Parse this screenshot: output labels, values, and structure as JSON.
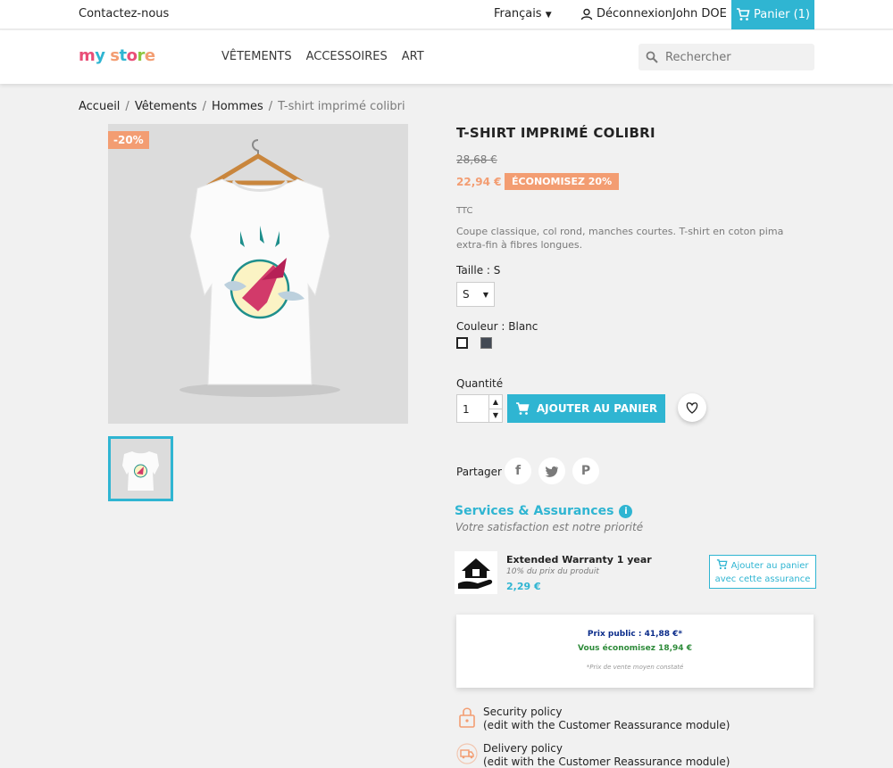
{
  "topbar": {
    "contact": "Contactez-nous",
    "language": "Français",
    "logout": "Déconnexion",
    "user": "John DOE",
    "cart": "Panier (1)"
  },
  "header": {
    "logo": "my store",
    "nav": [
      "VÊTEMENTS",
      "ACCESSOIRES",
      "ART"
    ],
    "search_placeholder": "Rechercher"
  },
  "breadcrumb": [
    "Accueil",
    "Vêtements",
    "Hommes",
    "T-shirt imprimé colibri"
  ],
  "product": {
    "discount_flag": "-20%",
    "title": "T-SHIRT IMPRIMÉ COLIBRI",
    "old_price": "28,68 €",
    "price": "22,94 €",
    "save_badge": "ÉCONOMISEZ 20%",
    "tax_label": "TTC",
    "description": "Coupe classique, col rond, manches courtes. T-shirt en coton pima extra-fin à fibres longues.",
    "size_label": "Taille : S",
    "size_value": "S",
    "color_label": "Couleur : Blanc",
    "colors": [
      "#ffffff",
      "#434a54"
    ],
    "qty_label": "Quantité",
    "qty_value": "1",
    "add_to_cart": "AJOUTER AU PANIER",
    "share_label": "Partager"
  },
  "services": {
    "title": "Services & Assurances",
    "subtitle": "Votre satisfaction est notre priorité",
    "warranty_name": "Extended Warranty 1 year",
    "warranty_sub": "10% du prix du produit",
    "warranty_price": "2,29 €",
    "warranty_btn_line1": "Ajouter au panier",
    "warranty_btn_line2": "avec cette assurance"
  },
  "pricebox": {
    "public_price": "Prix public : 41,88 €*",
    "savings": "Vous économisez 18,94 €",
    "note": "*Prix de vente moyen constaté"
  },
  "reassurance": [
    {
      "title": "Security policy",
      "sub": "(edit with the Customer Reassurance module)"
    },
    {
      "title": "Delivery policy",
      "sub": "(edit with the Customer Reassurance module)"
    }
  ],
  "accent": "#2fb5d2",
  "sale_color": "#f39d72"
}
